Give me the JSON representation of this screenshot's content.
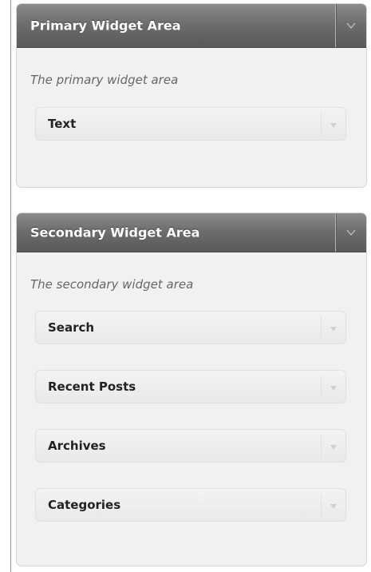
{
  "primary": {
    "title": "Primary Widget Area",
    "description": "The primary widget area",
    "widgets": [
      {
        "title": "Text"
      }
    ]
  },
  "secondary": {
    "title": "Secondary Widget Area",
    "description": "The secondary widget area",
    "widgets": [
      {
        "title": "Search"
      },
      {
        "title": "Recent Posts"
      },
      {
        "title": "Archives"
      },
      {
        "title": "Categories"
      }
    ]
  },
  "icons": {
    "sidebar_toggle": "chevron-down-icon",
    "widget_toggle": "triangle-down-icon"
  },
  "colors": {
    "header_bg": "#6e6e6e",
    "header_text": "#ffffff",
    "panel_bg": "#f1f1f1",
    "widget_bg": "#ececec"
  }
}
